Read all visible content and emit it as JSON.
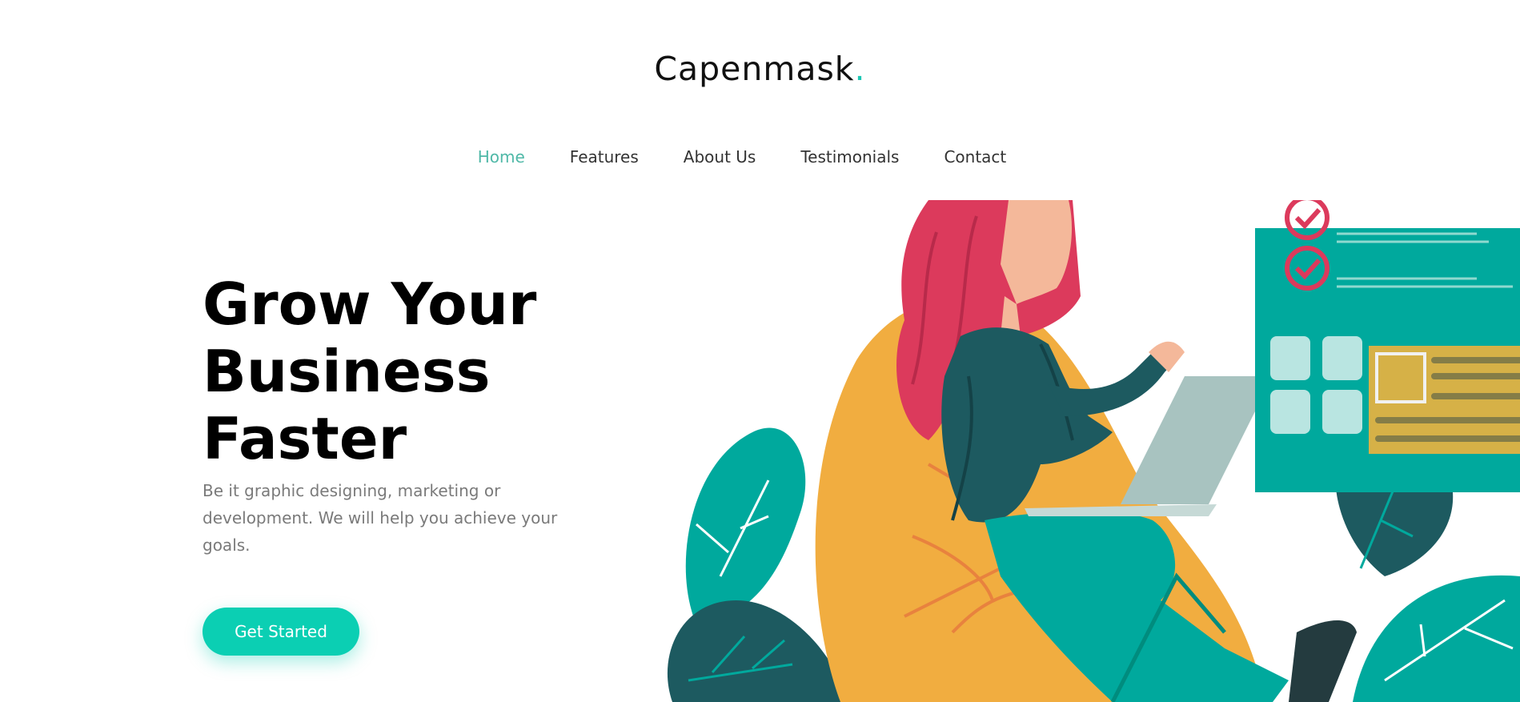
{
  "brand": {
    "name": "Capenmask",
    "dot": "."
  },
  "nav": [
    {
      "label": "Home",
      "active": true
    },
    {
      "label": "Features",
      "active": false
    },
    {
      "label": "About Us",
      "active": false
    },
    {
      "label": "Testimonials",
      "active": false
    },
    {
      "label": "Contact",
      "active": false
    }
  ],
  "hero": {
    "title_lines": [
      "Grow Your",
      "Business",
      "Faster"
    ],
    "subtitle": "Be it graphic designing, marketing or development. We will help you achieve your goals.",
    "cta_label": "Get Started"
  },
  "colors": {
    "accent": "#0bcfb3",
    "nav_active": "#4fb8a7",
    "teal": "#00a99d",
    "dark_teal": "#1d5a60",
    "yellow": "#f1ad40",
    "hair_red": "#dc3a5c"
  },
  "illustration": {
    "name": "woman-on-beanbag-with-laptop-illustration"
  }
}
